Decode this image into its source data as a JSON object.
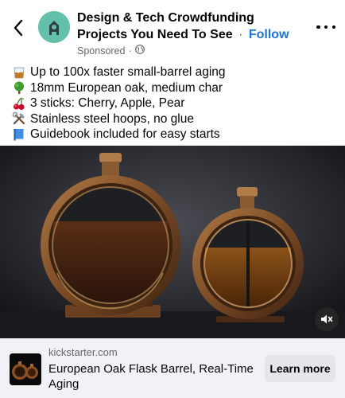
{
  "post": {
    "page_name": "Design & Tech Crowdfunding Projects You Need To See",
    "separator": "·",
    "follow_label": "Follow",
    "sponsored_label": "Sponsored",
    "dot": "·"
  },
  "caption": {
    "lines": [
      {
        "icon": "whiskey-glass-icon",
        "text": "Up to 100x faster small-barrel aging"
      },
      {
        "icon": "tree-icon",
        "text": "18mm European oak, medium char"
      },
      {
        "icon": "cherries-icon",
        "text": "3 sticks: Cherry, Apple, Pear"
      },
      {
        "icon": "tools-icon",
        "text": "Stainless steel hoops, no glue"
      },
      {
        "icon": "book-icon",
        "text": "Guidebook included for easy starts"
      }
    ]
  },
  "media": {
    "description_icon": "flask-barrel-photo",
    "mute_icon": "speaker-muted-icon"
  },
  "footer": {
    "domain": "kickstarter.com",
    "product_title": "European Oak Flask Barrel, Real-Time Aging",
    "cta_label": "Learn more"
  },
  "colors": {
    "follow": "#1b74e4",
    "footer_bg": "#f0f2f5",
    "button_bg": "#e4e6eb"
  }
}
